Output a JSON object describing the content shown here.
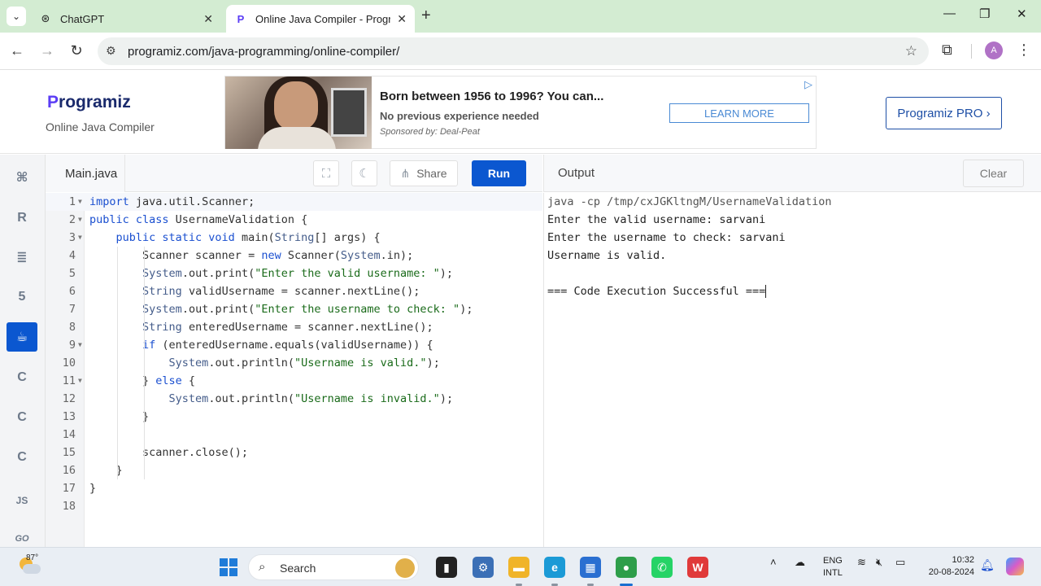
{
  "browser": {
    "tabs": [
      {
        "title": "ChatGPT",
        "icon": "chatgpt-icon",
        "active": false
      },
      {
        "title": "Online Java Compiler - Progran",
        "icon": "programiz-icon",
        "active": true
      }
    ],
    "url": "programiz.com/java-programming/online-compiler/",
    "profile_initial": "A"
  },
  "header": {
    "logo": {
      "first": "P",
      "rest": "rogramiz"
    },
    "subtitle": "Online Java Compiler",
    "ad": {
      "title": "Born between 1956 to 1996? You can...",
      "line": "No previous experience needed",
      "sponsor": "Sponsored by: Deal-Peat",
      "cta": "LEARN MORE",
      "choice_icon": "ad-choices-icon"
    },
    "pro_button": "Programiz PRO ›"
  },
  "sidebar": {
    "languages": [
      {
        "name": "python",
        "icon": "python-icon",
        "glyph": "⌘"
      },
      {
        "name": "r",
        "icon": "r-icon",
        "glyph": "R"
      },
      {
        "name": "sql",
        "icon": "database-icon",
        "glyph": "≣"
      },
      {
        "name": "html",
        "icon": "html5-icon",
        "glyph": "5"
      },
      {
        "name": "java",
        "icon": "java-icon",
        "glyph": "☕",
        "active": true
      },
      {
        "name": "c",
        "icon": "c-icon",
        "glyph": "C"
      },
      {
        "name": "csharp",
        "icon": "csharp-icon",
        "glyph": "C"
      },
      {
        "name": "cpp",
        "icon": "cpp-icon",
        "glyph": "C"
      },
      {
        "name": "js",
        "icon": "js-icon",
        "glyph": "JS"
      },
      {
        "name": "go",
        "icon": "go-icon",
        "glyph": "GO"
      }
    ]
  },
  "editor": {
    "filename": "Main.java",
    "share_label": "Share",
    "run_label": "Run",
    "lines": [
      {
        "n": "1",
        "fold": true,
        "html": "<span class=\"k\">import</span> java.util.Scanner;"
      },
      {
        "n": "2",
        "fold": true,
        "html": "<span class=\"k\">public class</span> UsernameValidation {"
      },
      {
        "n": "3",
        "fold": true,
        "html": "    <span class=\"k\">public static void</span> main(<span class=\"t\">String</span>[] args) {"
      },
      {
        "n": "4",
        "fold": false,
        "html": "        Scanner scanner = <span class=\"k\">new</span> Scanner(<span class=\"t\">System</span>.in);"
      },
      {
        "n": "5",
        "fold": false,
        "html": "        <span class=\"t\">System</span>.out.print(<span class=\"s\">\"Enter the valid username: \"</span>);"
      },
      {
        "n": "6",
        "fold": false,
        "html": "        <span class=\"t\">String</span> validUsername = scanner.nextLine();"
      },
      {
        "n": "7",
        "fold": false,
        "html": "        <span class=\"t\">System</span>.out.print(<span class=\"s\">\"Enter the username to check: \"</span>);"
      },
      {
        "n": "8",
        "fold": false,
        "html": "        <span class=\"t\">String</span> enteredUsername = scanner.nextLine();"
      },
      {
        "n": "9",
        "fold": true,
        "html": "        <span class=\"k\">if</span> (enteredUsername.equals(validUsername)) {"
      },
      {
        "n": "10",
        "fold": false,
        "html": "            <span class=\"t\">System</span>.out.println(<span class=\"s\">\"Username is valid.\"</span>);"
      },
      {
        "n": "11",
        "fold": true,
        "html": "        } <span class=\"k\">else</span> {"
      },
      {
        "n": "12",
        "fold": false,
        "html": "            <span class=\"t\">System</span>.out.println(<span class=\"s\">\"Username is invalid.\"</span>);"
      },
      {
        "n": "13",
        "fold": false,
        "html": "        }"
      },
      {
        "n": "14",
        "fold": false,
        "html": ""
      },
      {
        "n": "15",
        "fold": false,
        "html": "        scanner.close();"
      },
      {
        "n": "16",
        "fold": false,
        "html": "    }"
      },
      {
        "n": "17",
        "fold": false,
        "html": "}"
      },
      {
        "n": "18",
        "fold": false,
        "html": ""
      }
    ]
  },
  "output": {
    "title": "Output",
    "clear_label": "Clear",
    "lines": [
      {
        "text": "java -cp /tmp/cxJGKltngM/UsernameValidation",
        "kind": "cmd"
      },
      {
        "text": "Enter the valid username: sarvani",
        "kind": "out"
      },
      {
        "text": "Enter the username to check: sarvani",
        "kind": "out"
      },
      {
        "text": "Username is valid.",
        "kind": "out"
      },
      {
        "text": "",
        "kind": "out"
      },
      {
        "text": "=== Code Execution Successful ===",
        "kind": "out",
        "caret": true
      }
    ]
  },
  "taskbar": {
    "temperature": "87°",
    "search_label": "Search",
    "apps": [
      {
        "name": "file-viewer-icon",
        "color": "#222222",
        "glyph": "▮"
      },
      {
        "name": "settings-icon",
        "color": "#3b6fb6",
        "glyph": "⚙"
      },
      {
        "name": "file-explorer-icon",
        "color": "#f0b429",
        "glyph": "▬"
      },
      {
        "name": "edge-icon",
        "color": "#1b9ad6",
        "glyph": "e"
      },
      {
        "name": "store-icon",
        "color": "#2a6fd1",
        "glyph": "▦"
      },
      {
        "name": "chrome-icon",
        "color": "#2e9e4a",
        "glyph": "●"
      },
      {
        "name": "whatsapp-icon",
        "color": "#25d366",
        "glyph": "✆"
      },
      {
        "name": "wps-icon",
        "color": "#e03a3a",
        "glyph": "W"
      }
    ],
    "lang_top": "ENG",
    "lang_bottom": "INTL",
    "time": "10:32",
    "date": "20-08-2024"
  }
}
